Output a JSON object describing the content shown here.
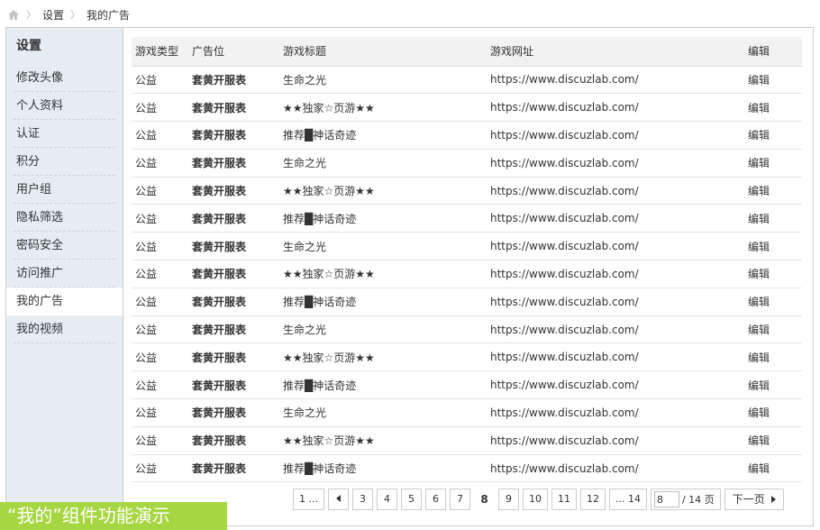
{
  "breadcrumb": {
    "items": [
      "设置",
      "我的广告"
    ]
  },
  "sidebar": {
    "title": "设置",
    "items": [
      {
        "label": "修改头像",
        "active": false
      },
      {
        "label": "个人资料",
        "active": false
      },
      {
        "label": "认证",
        "active": false
      },
      {
        "label": "积分",
        "active": false
      },
      {
        "label": "用户组",
        "active": false
      },
      {
        "label": "隐私筛选",
        "active": false
      },
      {
        "label": "密码安全",
        "active": false
      },
      {
        "label": "访问推广",
        "active": false
      },
      {
        "label": "我的广告",
        "active": true
      },
      {
        "label": "我的视频",
        "active": false
      }
    ]
  },
  "table": {
    "headers": [
      "游戏类型",
      "广告位",
      "游戏标题",
      "游戏网址",
      "编辑"
    ],
    "rows": [
      [
        "公益",
        "套黄开服表",
        "生命之光",
        "https://www.discuzlab.com/",
        "编辑"
      ],
      [
        "公益",
        "套黄开服表",
        "★★独家☆页游★★",
        "https://www.discuzlab.com/",
        "编辑"
      ],
      [
        "公益",
        "套黄开服表",
        "推荐█神话奇迹",
        "https://www.discuzlab.com/",
        "编辑"
      ],
      [
        "公益",
        "套黄开服表",
        "生命之光",
        "https://www.discuzlab.com/",
        "编辑"
      ],
      [
        "公益",
        "套黄开服表",
        "★★独家☆页游★★",
        "https://www.discuzlab.com/",
        "编辑"
      ],
      [
        "公益",
        "套黄开服表",
        "推荐█神话奇迹",
        "https://www.discuzlab.com/",
        "编辑"
      ],
      [
        "公益",
        "套黄开服表",
        "生命之光",
        "https://www.discuzlab.com/",
        "编辑"
      ],
      [
        "公益",
        "套黄开服表",
        "★★独家☆页游★★",
        "https://www.discuzlab.com/",
        "编辑"
      ],
      [
        "公益",
        "套黄开服表",
        "推荐█神话奇迹",
        "https://www.discuzlab.com/",
        "编辑"
      ],
      [
        "公益",
        "套黄开服表",
        "生命之光",
        "https://www.discuzlab.com/",
        "编辑"
      ],
      [
        "公益",
        "套黄开服表",
        "★★独家☆页游★★",
        "https://www.discuzlab.com/",
        "编辑"
      ],
      [
        "公益",
        "套黄开服表",
        "推荐█神话奇迹",
        "https://www.discuzlab.com/",
        "编辑"
      ],
      [
        "公益",
        "套黄开服表",
        "生命之光",
        "https://www.discuzlab.com/",
        "编辑"
      ],
      [
        "公益",
        "套黄开服表",
        "★★独家☆页游★★",
        "https://www.discuzlab.com/",
        "编辑"
      ],
      [
        "公益",
        "套黄开服表",
        "推荐█神话奇迹",
        "https://www.discuzlab.com/",
        "编辑"
      ]
    ]
  },
  "pagination": {
    "first": "1 ...",
    "prev_icon": "chevron-left-icon",
    "pages": [
      "3",
      "4",
      "5",
      "6",
      "7",
      "8",
      "9",
      "10",
      "11",
      "12"
    ],
    "current": "8",
    "last": "... 14",
    "input_value": "8",
    "total_label": "/ 14 页",
    "next_label": "下一页",
    "next_icon": "chevron-right-icon"
  },
  "caption": "“我的”组件功能演示",
  "colors": {
    "accent": "#e86b0e",
    "sidebar_bg": "#e5edf2",
    "caption_bg": "#a6d641"
  }
}
